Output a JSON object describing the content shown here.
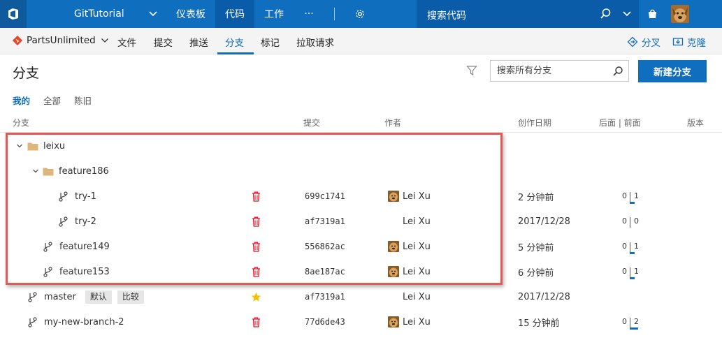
{
  "topbar": {
    "project_name": "GitTutorial",
    "hubs": [
      {
        "label": "仪表板",
        "active": false
      },
      {
        "label": "代码",
        "active": true
      },
      {
        "label": "工作",
        "active": false
      },
      {
        "label": "···",
        "active": false
      }
    ],
    "search_placeholder": "搜索代码",
    "icons": [
      "vsts-logo-icon",
      "chevron-down-icon",
      "gear-icon",
      "search-icon",
      "shopping-bag-icon",
      "user-avatar"
    ]
  },
  "subnav": {
    "repo_name": "PartsUnlimited",
    "tabs": [
      {
        "label": "文件",
        "active": false
      },
      {
        "label": "提交",
        "active": false
      },
      {
        "label": "推送",
        "active": false
      },
      {
        "label": "分支",
        "active": true
      },
      {
        "label": "标记",
        "active": false
      },
      {
        "label": "拉取请求",
        "active": false
      }
    ],
    "fork_label": "分叉",
    "clone_label": "克隆"
  },
  "page": {
    "title": "分支",
    "search_placeholder": "搜索所有分支",
    "new_branch_label": "新建分支",
    "pivots": [
      {
        "label": "我的",
        "active": true
      },
      {
        "label": "全部",
        "active": false
      },
      {
        "label": "陈旧",
        "active": false
      }
    ]
  },
  "columns": {
    "branch": "分支",
    "commit": "提交",
    "author": "作者",
    "date": "创作日期",
    "behind_ahead": "后面 | 前面",
    "version": "版本"
  },
  "rows": [
    {
      "type": "folder",
      "name": "leixu",
      "level": 0,
      "expanded": true
    },
    {
      "type": "folder",
      "name": "feature186",
      "level": 1,
      "expanded": true
    },
    {
      "type": "branch",
      "name": "try-1",
      "level": 2,
      "commit": "699c1741",
      "author": "Lei Xu",
      "has_avatar": true,
      "date": "2 分钟前",
      "behind": "0",
      "ahead": "1",
      "ahead_bar": true,
      "action_icon": "trash-icon"
    },
    {
      "type": "branch",
      "name": "try-2",
      "level": 2,
      "commit": "af7319a1",
      "author": "Lei Xu",
      "has_avatar": false,
      "date": "2017/12/28",
      "behind": "0",
      "ahead": "0",
      "ahead_bar": false,
      "action_icon": "trash-icon"
    },
    {
      "type": "branch",
      "name": "feature149",
      "level": 1,
      "commit": "556862ac",
      "author": "Lei Xu",
      "has_avatar": true,
      "date": "5 分钟前",
      "behind": "0",
      "ahead": "1",
      "ahead_bar": true,
      "action_icon": "trash-icon"
    },
    {
      "type": "branch",
      "name": "feature153",
      "level": 1,
      "commit": "8ae187ac",
      "author": "Lei Xu",
      "has_avatar": true,
      "date": "6 分钟前",
      "behind": "0",
      "ahead": "1",
      "ahead_bar": true,
      "action_icon": "trash-icon"
    },
    {
      "type": "branch",
      "name": "master",
      "level": 0,
      "badges": [
        "默认",
        "比较"
      ],
      "commit": "af7319a1",
      "author": "Lei Xu",
      "has_avatar": false,
      "date": "2017/12/28",
      "behind": "",
      "ahead": "",
      "ahead_bar": false,
      "action_icon": "star-icon"
    },
    {
      "type": "branch",
      "name": "my-new-branch-2",
      "level": 0,
      "commit": "77d6de43",
      "author": "Lei Xu",
      "has_avatar": true,
      "date": "15 分钟前",
      "behind": "0",
      "ahead": "2",
      "ahead_bar": true,
      "action_icon": "trash-icon"
    }
  ],
  "colors": {
    "accent": "#106ebe",
    "topbar": "#106ebe",
    "trash": "#e81123",
    "star": "#f8c000",
    "highlight": "#e05b57"
  }
}
